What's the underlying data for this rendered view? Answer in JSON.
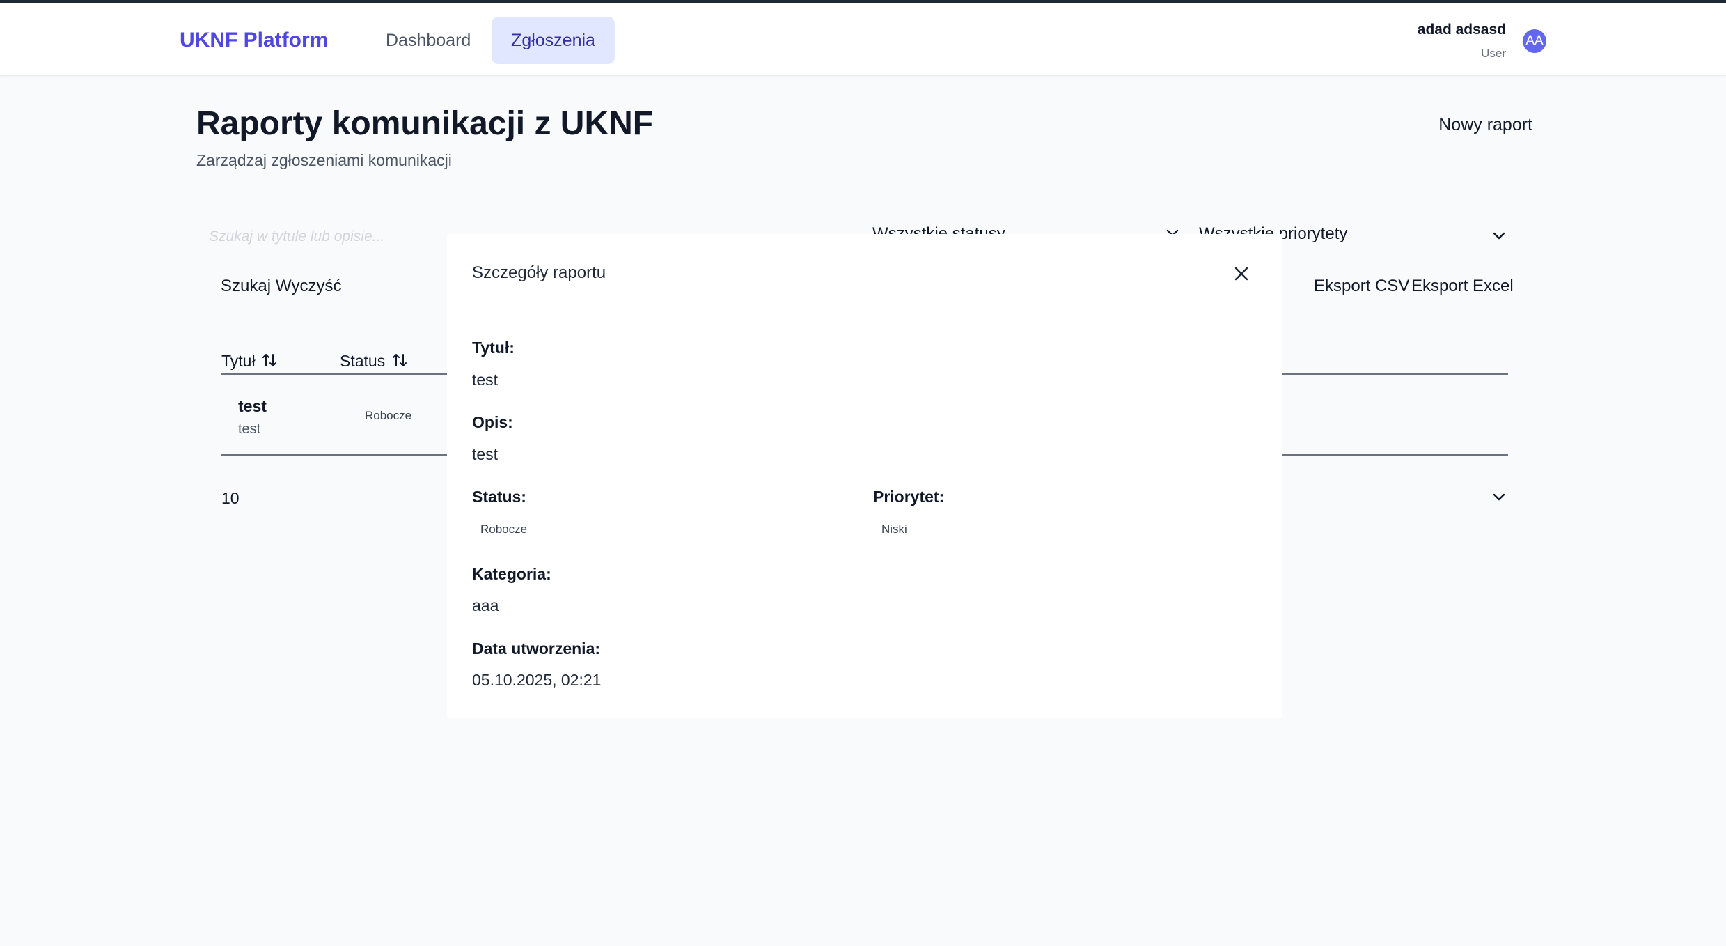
{
  "header": {
    "brand": "UKNF Platform",
    "nav": [
      "Dashboard",
      "Zgłoszenia"
    ],
    "active_nav": "Zgłoszenia",
    "user": {
      "name": "adad adsasd",
      "role": "User",
      "initials": "AA"
    }
  },
  "page": {
    "title": "Raporty komunikacji z UKNF",
    "subtitle": "Zarządzaj zgłoszeniami komunikacji",
    "new_report_label": "Nowy raport"
  },
  "filters": {
    "search_placeholder": "Szukaj w tytule lub opisie...",
    "status_selected": "Wszystkie statusy",
    "priority_selected": "Wszystkie priorytety",
    "search_label": "Szukaj",
    "clear_label": "Wyczyść",
    "export_csv_label": "Eksport CSV",
    "export_excel_label": "Eksport Excel"
  },
  "table": {
    "headers": [
      "Tytuł",
      "Status"
    ],
    "rows": [
      {
        "title": "test",
        "description": "test",
        "status": "Robocze"
      }
    ],
    "page_size": "10"
  },
  "modal": {
    "title": "Szczegóły raportu",
    "fields": {
      "title_label": "Tytuł:",
      "title_value": "test",
      "desc_label": "Opis:",
      "desc_value": "test",
      "status_label": "Status:",
      "status_value": "Robocze",
      "priority_label": "Priorytet:",
      "priority_value": "Niski",
      "category_label": "Kategoria:",
      "category_value": "aaa",
      "created_label": "Data utworzenia:",
      "created_value": "05.10.2025, 02:21"
    }
  },
  "colors": {
    "brand": "#4f46e5",
    "nav_active_bg": "#e0e7ff",
    "avatar_bg": "#6366f1",
    "page_bg": "#f9fafb"
  }
}
